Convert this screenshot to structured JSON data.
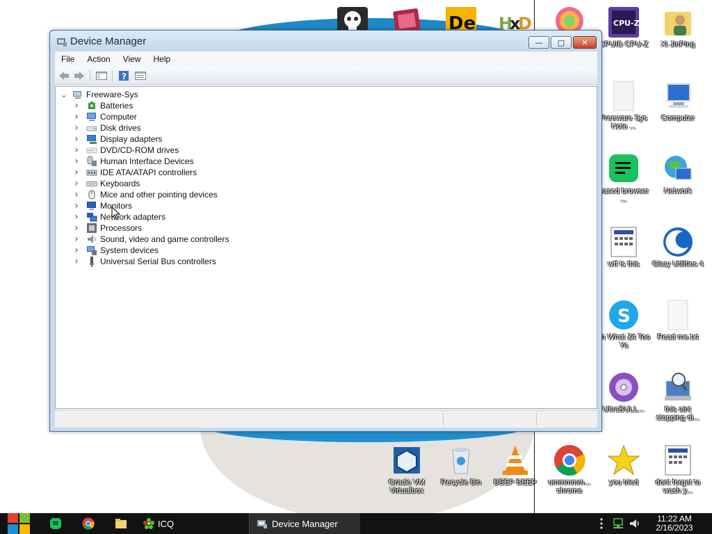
{
  "window": {
    "title": "Device Manager",
    "controls": {
      "minimize_icon": "minimize-icon",
      "maximize_icon": "maximize-icon",
      "close_icon": "close-icon"
    }
  },
  "menu": [
    "File",
    "Action",
    "View",
    "Help"
  ],
  "toolbar": [
    "back-arrow-icon",
    "forward-arrow-icon",
    "show-hide-console-tree-icon",
    "help-icon",
    "properties-icon"
  ],
  "tree": {
    "root": "Freeware-Sys",
    "items": [
      {
        "label": "Batteries",
        "icon": "battery-icon"
      },
      {
        "label": "Computer",
        "icon": "computer-icon"
      },
      {
        "label": "Disk drives",
        "icon": "disk-drive-icon"
      },
      {
        "label": "Display adapters",
        "icon": "display-adapter-icon"
      },
      {
        "label": "DVD/CD-ROM drives",
        "icon": "dvd-drive-icon"
      },
      {
        "label": "Human Interface Devices",
        "icon": "hid-icon"
      },
      {
        "label": "IDE ATA/ATAPI controllers",
        "icon": "ide-controller-icon"
      },
      {
        "label": "Keyboards",
        "icon": "keyboard-icon"
      },
      {
        "label": "Mice and other pointing devices",
        "icon": "mouse-icon"
      },
      {
        "label": "Monitors",
        "icon": "monitor-icon"
      },
      {
        "label": "Network adapters",
        "icon": "network-adapter-icon"
      },
      {
        "label": "Processors",
        "icon": "processor-icon"
      },
      {
        "label": "Sound, video and game controllers",
        "icon": "speaker-icon"
      },
      {
        "label": "System devices",
        "icon": "system-devices-icon"
      },
      {
        "label": "Universal Serial Bus controllers",
        "icon": "usb-icon"
      }
    ]
  },
  "desktop_icons": {
    "top_row": [
      "skull-icon",
      "media-app-icon",
      "de-app-icon",
      "hxd-icon",
      "colorful-app-icon"
    ],
    "cpuz": "CPUID CPU-Z",
    "xi": "Xi JinPing",
    "freeware_note": "Freeware Sys Note ...",
    "computer": "Computer",
    "browser": "based browser ...",
    "network": "Network",
    "wtf": "wtf is this",
    "glary": "Glary Utilities 4",
    "skype": "sh What Zit Too Ya",
    "readme": "Read me.txt",
    "ultrabull": "UltraBULL...",
    "stopping": "this aint stopping di...",
    "vbox": "Oracle VM Virtualbox",
    "recycle": "Recycle Bin",
    "beep": "BEEP BEEP",
    "chrome": "ummmmm... chrome",
    "youtried": "you tried",
    "wash": "dont forget to wash y..."
  },
  "taskbar": {
    "icq_label": "ICQ",
    "active_task": "Device Manager",
    "time": "11:22 AM",
    "date": "2/16/2023",
    "colors": {
      "bg": "#121212",
      "start_red": "#e8412b",
      "start_green": "#7cbd2f",
      "start_blue": "#1e90d6",
      "start_yellow": "#f7b800"
    }
  }
}
